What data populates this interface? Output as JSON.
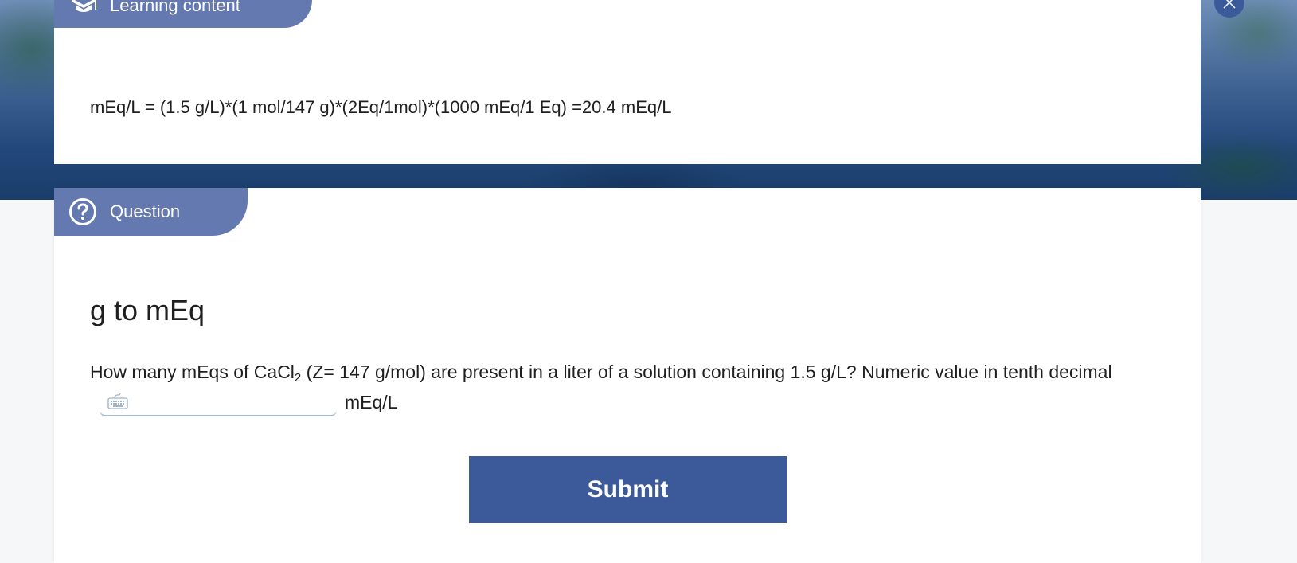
{
  "learning": {
    "tab_label": "Learning content",
    "tab_icon": "graduation-cap-icon",
    "formula": "mEq/L = (1.5 g/L)*(1 mol/147 g)*(2Eq/1mol)*(1000 mEq/1 Eq) =20.4 mEq/L",
    "close_icon": "close-icon"
  },
  "question": {
    "tab_label": "Question",
    "tab_icon": "help-circle-icon",
    "title": "g to mEq",
    "text_part1": "How many mEqs of CaCl",
    "text_sub": "2",
    "text_part2": " (Z= 147 g/mol) are present in a liter of a solution containing 1.5 g/L? Numeric value in tenth decimal",
    "answer_value": "",
    "answer_placeholder": "",
    "keyboard_icon": "keyboard-icon",
    "unit": "mEq/L",
    "submit_label": "Submit"
  },
  "colors": {
    "tab_bg": "#6479b0",
    "submit_bg": "#3c5a99",
    "close_bg": "#3a5a9a",
    "input_underline": "#a9bccb"
  }
}
